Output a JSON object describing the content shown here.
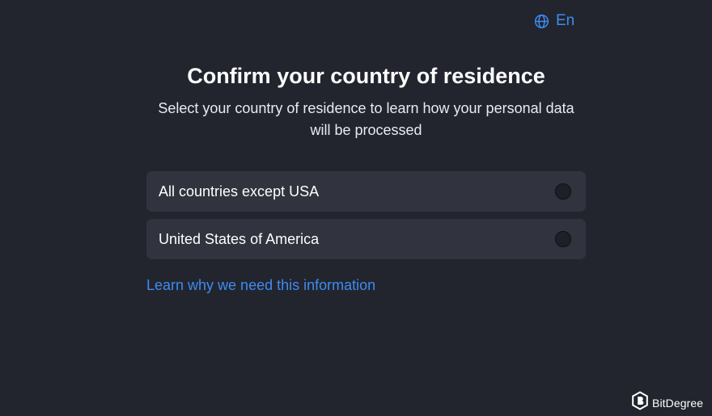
{
  "language": {
    "label": "En",
    "icon": "globe-icon"
  },
  "header": {
    "title": "Confirm your country of residence",
    "subtitle": "Select your country of residence to learn how your personal data will be processed"
  },
  "options": [
    {
      "label": "All countries except USA",
      "selected": false
    },
    {
      "label": "United States of America",
      "selected": false
    }
  ],
  "learn_link": "Learn why we need this information",
  "watermark": {
    "text": "BitDegree",
    "icon": "bitdegree-logo-icon"
  },
  "colors": {
    "background": "#22252e",
    "option_background": "#31343e",
    "accent": "#3e8bf0",
    "text": "#ffffff"
  }
}
